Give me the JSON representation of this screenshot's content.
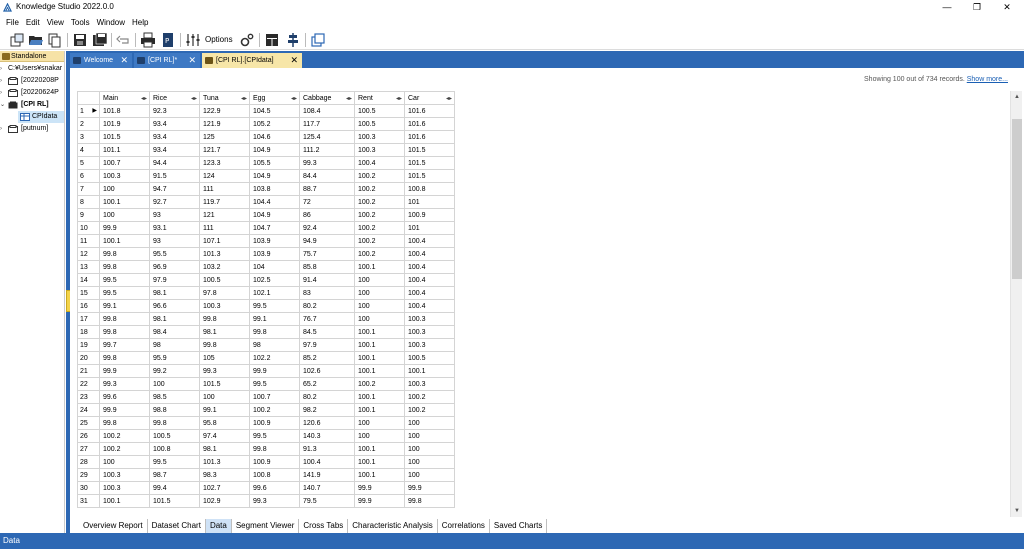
{
  "window": {
    "title": "Knowledge Studio 2022.0.0",
    "minimize": "—",
    "maximize": "❐",
    "close": "✕"
  },
  "menu": [
    "File",
    "Edit",
    "View",
    "Tools",
    "Window",
    "Help"
  ],
  "toolbar": {
    "options_label": "Options"
  },
  "tree": {
    "header": "Standalone",
    "items": [
      {
        "label": "C:¥Users¥snakar",
        "twisty": "›"
      },
      {
        "label": "[20220208P",
        "twisty": "›"
      },
      {
        "label": "[20220624P",
        "twisty": "›"
      },
      {
        "label": "[CPI RL]",
        "twisty": "⌄"
      },
      {
        "label": "CPIdata",
        "twisty": ""
      },
      {
        "label": "[putnum]",
        "twisty": "›"
      }
    ]
  },
  "doc_tabs": [
    {
      "label": "Welcome",
      "close": "✕"
    },
    {
      "label": "[CPI RL]*",
      "close": "✕"
    },
    {
      "label": "[CPI RL].[CPIdata]",
      "close": "✕"
    }
  ],
  "records": {
    "text": "Showing 100 out of 734 records. ",
    "link": "Show more..."
  },
  "grid": {
    "columns": [
      "Main",
      "Rice",
      "Tuna",
      "Egg",
      "Cabbage",
      "Rent",
      "Car"
    ],
    "rows": [
      [
        "1",
        "101.8",
        "92.3",
        "122.9",
        "104.5",
        "108.4",
        "100.5",
        "101.6"
      ],
      [
        "2",
        "101.9",
        "93.4",
        "121.9",
        "105.2",
        "117.7",
        "100.5",
        "101.6"
      ],
      [
        "3",
        "101.5",
        "93.4",
        "125",
        "104.6",
        "125.4",
        "100.3",
        "101.6"
      ],
      [
        "4",
        "101.1",
        "93.4",
        "121.7",
        "104.9",
        "111.2",
        "100.3",
        "101.5"
      ],
      [
        "5",
        "100.7",
        "94.4",
        "123.3",
        "105.5",
        "99.3",
        "100.4",
        "101.5"
      ],
      [
        "6",
        "100.3",
        "91.5",
        "124",
        "104.9",
        "84.4",
        "100.2",
        "101.5"
      ],
      [
        "7",
        "100",
        "94.7",
        "111",
        "103.8",
        "88.7",
        "100.2",
        "100.8"
      ],
      [
        "8",
        "100.1",
        "92.7",
        "119.7",
        "104.4",
        "72",
        "100.2",
        "101"
      ],
      [
        "9",
        "100",
        "93",
        "121",
        "104.9",
        "86",
        "100.2",
        "100.9"
      ],
      [
        "10",
        "99.9",
        "93.1",
        "111",
        "104.7",
        "92.4",
        "100.2",
        "101"
      ],
      [
        "11",
        "100.1",
        "93",
        "107.1",
        "103.9",
        "94.9",
        "100.2",
        "100.4"
      ],
      [
        "12",
        "99.8",
        "95.5",
        "101.3",
        "103.9",
        "75.7",
        "100.2",
        "100.4"
      ],
      [
        "13",
        "99.8",
        "96.9",
        "103.2",
        "104",
        "85.8",
        "100.1",
        "100.4"
      ],
      [
        "14",
        "99.5",
        "97.9",
        "100.5",
        "102.5",
        "91.4",
        "100",
        "100.4"
      ],
      [
        "15",
        "99.5",
        "98.1",
        "97.8",
        "102.1",
        "83",
        "100",
        "100.4"
      ],
      [
        "16",
        "99.1",
        "96.6",
        "100.3",
        "99.5",
        "80.2",
        "100",
        "100.4"
      ],
      [
        "17",
        "99.8",
        "98.1",
        "99.8",
        "99.1",
        "76.7",
        "100",
        "100.3"
      ],
      [
        "18",
        "99.8",
        "98.4",
        "98.1",
        "99.8",
        "84.5",
        "100.1",
        "100.3"
      ],
      [
        "19",
        "99.7",
        "98",
        "99.8",
        "98",
        "97.9",
        "100.1",
        "100.3"
      ],
      [
        "20",
        "99.8",
        "95.9",
        "105",
        "102.2",
        "85.2",
        "100.1",
        "100.5"
      ],
      [
        "21",
        "99.9",
        "99.2",
        "99.3",
        "99.9",
        "102.6",
        "100.1",
        "100.1"
      ],
      [
        "22",
        "99.3",
        "100",
        "101.5",
        "99.5",
        "65.2",
        "100.2",
        "100.3"
      ],
      [
        "23",
        "99.6",
        "98.5",
        "100",
        "100.7",
        "80.2",
        "100.1",
        "100.2"
      ],
      [
        "24",
        "99.9",
        "98.8",
        "99.1",
        "100.2",
        "98.2",
        "100.1",
        "100.2"
      ],
      [
        "25",
        "99.8",
        "99.8",
        "95.8",
        "100.9",
        "120.6",
        "100",
        "100"
      ],
      [
        "26",
        "100.2",
        "100.5",
        "97.4",
        "99.5",
        "140.3",
        "100",
        "100"
      ],
      [
        "27",
        "100.2",
        "100.8",
        "98.1",
        "99.8",
        "91.3",
        "100.1",
        "100"
      ],
      [
        "28",
        "100",
        "99.5",
        "101.3",
        "100.9",
        "100.4",
        "100.1",
        "100"
      ],
      [
        "29",
        "100.3",
        "98.7",
        "98.3",
        "100.8",
        "141.9",
        "100.1",
        "100"
      ],
      [
        "30",
        "100.3",
        "99.4",
        "102.7",
        "99.6",
        "140.7",
        "99.9",
        "99.9"
      ],
      [
        "31",
        "100.1",
        "101.5",
        "102.9",
        "99.3",
        "79.5",
        "99.9",
        "99.8"
      ]
    ]
  },
  "bottom_tabs": [
    "Overview Report",
    "Dataset Chart",
    "Data",
    "Segment Viewer",
    "Cross Tabs",
    "Characteristic Analysis",
    "Correlations",
    "Saved Charts"
  ],
  "status": "Data",
  "colors": {
    "chrome_blue": "#2d68b4",
    "tab_active": "#f7e6a8",
    "tree_header": "#f6e2a6"
  }
}
